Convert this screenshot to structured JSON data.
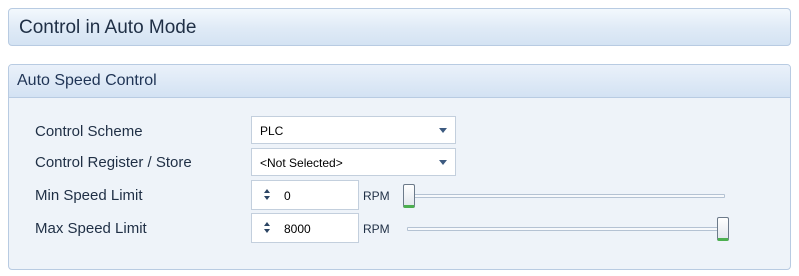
{
  "page": {
    "title": "Control in Auto Mode"
  },
  "section": {
    "title": "Auto Speed Control",
    "control_scheme": {
      "label": "Control Scheme",
      "value": "PLC",
      "icon": "chevron-down-icon"
    },
    "control_register": {
      "label": "Control Register / Store",
      "value": "<Not Selected>",
      "icon": "chevron-down-icon"
    },
    "min_speed": {
      "label": "Min Speed Limit",
      "value": "0",
      "unit": "RPM",
      "slider_fraction": 0.0
    },
    "max_speed": {
      "label": "Max Speed Limit",
      "value": "8000",
      "unit": "RPM",
      "slider_fraction": 1.0
    }
  },
  "colors": {
    "header_border": "#b8cbe2",
    "panel_background": "#eef3f9",
    "slider_thumb_accent": "#4caf50"
  }
}
